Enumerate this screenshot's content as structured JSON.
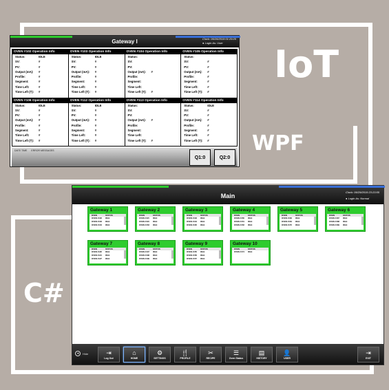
{
  "labels": {
    "iot": "IoT",
    "wpf": "WPF",
    "csharp": "C#"
  },
  "gateway_window": {
    "title": "Gateway I",
    "clock_label": "Clock:",
    "clock_value": "06/26/2019 01:29:20",
    "login_label": "Login As:",
    "login_value": "User",
    "field_labels": [
      "Status:",
      "SV:",
      "PV:",
      "Output (mA):",
      "Profile:",
      "Segment:",
      "Time Left:",
      "Time Left (T):"
    ],
    "ovens": [
      {
        "title": "OVEN #102 Operation Info",
        "values": [
          "IDLE",
          "#",
          "#",
          "#",
          "#",
          "#",
          "#",
          "#"
        ]
      },
      {
        "title": "OVEN #103 Operation Info",
        "values": [
          "IDLE",
          "#",
          "#",
          "#",
          "#",
          "#",
          "#",
          "#"
        ]
      },
      {
        "title": "OVEN #104 Operation Info",
        "values": [
          "",
          "",
          "",
          "#",
          "",
          "",
          "",
          "#"
        ]
      },
      {
        "title": "OVEN #105 Operation Info",
        "values": [
          "",
          "#",
          "#",
          "#",
          "#",
          "#",
          "#",
          "#"
        ]
      },
      {
        "title": "OVEN #106 Operation Info",
        "values": [
          "IDLE",
          "#",
          "#",
          "#",
          "#",
          "#",
          "#",
          "#"
        ]
      },
      {
        "title": "OVEN #112 Operation Info",
        "values": [
          "IDLE",
          "#",
          "#",
          "#",
          "#",
          "#",
          "#",
          "#"
        ]
      },
      {
        "title": "OVEN #113 Operation Info",
        "values": [
          "",
          "",
          "",
          "#",
          "",
          "",
          "",
          "#"
        ]
      },
      {
        "title": "OVEN #114 Operation Info",
        "values": [
          "IDLE",
          "#",
          "#",
          "#",
          "#",
          "#",
          "#",
          "#"
        ]
      }
    ],
    "message_cols": [
      "DATE TIME",
      "ERROR MESSAGES"
    ],
    "q1": "Q1:0",
    "q2": "Q2:0"
  },
  "main_window": {
    "title": "Main",
    "clock_label": "Clock:",
    "clock_value": "06/29/2019 23:23:55",
    "login_label": "Login As:",
    "login_value": "Normal",
    "list_headers": [
      "OVEN",
      "STATUS"
    ],
    "gateways": [
      {
        "name": "Gateway 1",
        "rows": [
          [
            "OVEN #102",
            "IDLE"
          ],
          [
            "OVEN #103",
            "IDLE"
          ],
          [
            "OVEN #104",
            "IDLE"
          ]
        ]
      },
      {
        "name": "Gateway 2",
        "rows": [
          [
            "OVEN #115",
            "IDLE"
          ],
          [
            "OVEN #116",
            "IDLE"
          ],
          [
            "OVEN #153",
            "IDLE"
          ]
        ]
      },
      {
        "name": "Gateway 3",
        "rows": [
          [
            "OVEN #133",
            "IDLE"
          ],
          [
            "OVEN #134",
            "IDLE"
          ],
          [
            "OVEN #135",
            "IDLE"
          ]
        ]
      },
      {
        "name": "Gateway 4",
        "rows": [
          [
            "OVEN #150",
            "IDLE"
          ],
          [
            "OVEN #151",
            "IDLE"
          ],
          [
            "OVEN #152",
            "IDLE"
          ]
        ]
      },
      {
        "name": "Gateway 5",
        "rows": [
          [
            "OVEN #163",
            "IDLE"
          ],
          [
            "OVEN #164",
            "IDLE"
          ],
          [
            "OVEN #170",
            "IDLE"
          ]
        ]
      },
      {
        "name": "Gateway 6",
        "rows": [
          [
            "OVEN #167",
            "IDLE"
          ],
          [
            "OVEN #168",
            "IDLE"
          ],
          [
            "OVEN #169",
            "IDLE"
          ]
        ]
      },
      {
        "name": "Gateway 7",
        "rows": [
          [
            "OVEN #120",
            "IDLE"
          ],
          [
            "OVEN #121",
            "IDLE"
          ],
          [
            "OVEN #127",
            "IDLE"
          ]
        ]
      },
      {
        "name": "Gateway 8",
        "rows": [
          [
            "OVEN #137",
            "IDLE"
          ],
          [
            "OVEN #138",
            "IDLE"
          ],
          [
            "OVEN #139",
            "IDLE"
          ]
        ]
      },
      {
        "name": "Gateway 9",
        "rows": [
          [
            "OVEN #155",
            "IDLE"
          ],
          [
            "OVEN #156",
            "IDLE"
          ],
          [
            "OVEN #157",
            "IDLE"
          ]
        ]
      },
      {
        "name": "Gateway 10",
        "rows": [
          [
            "OVEN #174",
            "IDLE"
          ]
        ]
      }
    ],
    "hide_label": "Hide",
    "nav": [
      {
        "label": "Log Out",
        "icon": "logout-icon",
        "glyph": "⇥"
      },
      {
        "label": "HOME",
        "icon": "home-icon",
        "glyph": "⌂",
        "active": true
      },
      {
        "label": "SETTINGS",
        "icon": "gear-icon",
        "glyph": "⚙"
      },
      {
        "label": "PROFILE",
        "icon": "profile-icon",
        "glyph": "🍴"
      },
      {
        "label": "RECIPE",
        "icon": "recipe-icon",
        "glyph": "✂"
      },
      {
        "label": "Oven Status",
        "icon": "list-icon",
        "glyph": "☰"
      },
      {
        "label": "HISTORY",
        "icon": "history-icon",
        "glyph": "▤"
      },
      {
        "label": "USER",
        "icon": "user-icon",
        "glyph": "👤"
      }
    ],
    "exit": {
      "label": "EXIT",
      "icon": "exit-icon",
      "glyph": "⇥"
    }
  }
}
